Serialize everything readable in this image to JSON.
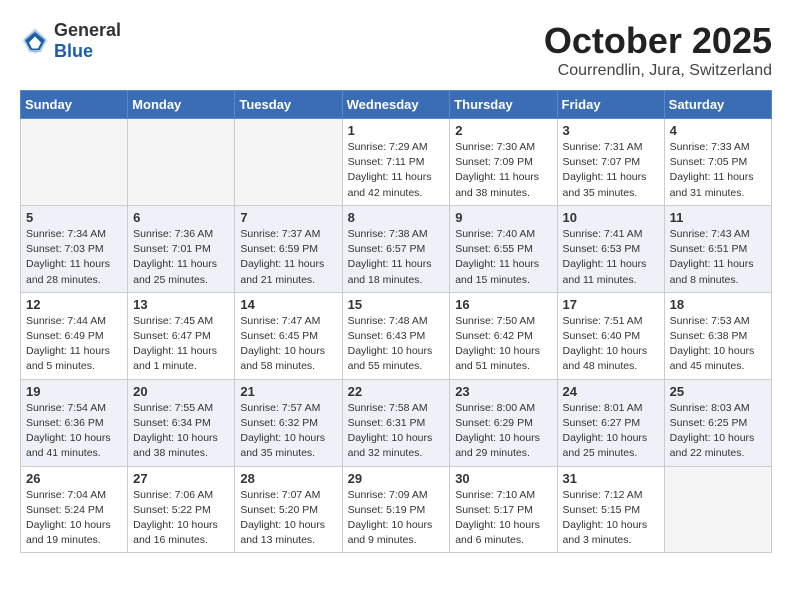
{
  "header": {
    "logo_general": "General",
    "logo_blue": "Blue",
    "month": "October 2025",
    "location": "Courrendlin, Jura, Switzerland"
  },
  "weekdays": [
    "Sunday",
    "Monday",
    "Tuesday",
    "Wednesday",
    "Thursday",
    "Friday",
    "Saturday"
  ],
  "weeks": [
    [
      {
        "day": "",
        "info": ""
      },
      {
        "day": "",
        "info": ""
      },
      {
        "day": "",
        "info": ""
      },
      {
        "day": "1",
        "info": "Sunrise: 7:29 AM\nSunset: 7:11 PM\nDaylight: 11 hours\nand 42 minutes."
      },
      {
        "day": "2",
        "info": "Sunrise: 7:30 AM\nSunset: 7:09 PM\nDaylight: 11 hours\nand 38 minutes."
      },
      {
        "day": "3",
        "info": "Sunrise: 7:31 AM\nSunset: 7:07 PM\nDaylight: 11 hours\nand 35 minutes."
      },
      {
        "day": "4",
        "info": "Sunrise: 7:33 AM\nSunset: 7:05 PM\nDaylight: 11 hours\nand 31 minutes."
      }
    ],
    [
      {
        "day": "5",
        "info": "Sunrise: 7:34 AM\nSunset: 7:03 PM\nDaylight: 11 hours\nand 28 minutes."
      },
      {
        "day": "6",
        "info": "Sunrise: 7:36 AM\nSunset: 7:01 PM\nDaylight: 11 hours\nand 25 minutes."
      },
      {
        "day": "7",
        "info": "Sunrise: 7:37 AM\nSunset: 6:59 PM\nDaylight: 11 hours\nand 21 minutes."
      },
      {
        "day": "8",
        "info": "Sunrise: 7:38 AM\nSunset: 6:57 PM\nDaylight: 11 hours\nand 18 minutes."
      },
      {
        "day": "9",
        "info": "Sunrise: 7:40 AM\nSunset: 6:55 PM\nDaylight: 11 hours\nand 15 minutes."
      },
      {
        "day": "10",
        "info": "Sunrise: 7:41 AM\nSunset: 6:53 PM\nDaylight: 11 hours\nand 11 minutes."
      },
      {
        "day": "11",
        "info": "Sunrise: 7:43 AM\nSunset: 6:51 PM\nDaylight: 11 hours\nand 8 minutes."
      }
    ],
    [
      {
        "day": "12",
        "info": "Sunrise: 7:44 AM\nSunset: 6:49 PM\nDaylight: 11 hours\nand 5 minutes."
      },
      {
        "day": "13",
        "info": "Sunrise: 7:45 AM\nSunset: 6:47 PM\nDaylight: 11 hours\nand 1 minute."
      },
      {
        "day": "14",
        "info": "Sunrise: 7:47 AM\nSunset: 6:45 PM\nDaylight: 10 hours\nand 58 minutes."
      },
      {
        "day": "15",
        "info": "Sunrise: 7:48 AM\nSunset: 6:43 PM\nDaylight: 10 hours\nand 55 minutes."
      },
      {
        "day": "16",
        "info": "Sunrise: 7:50 AM\nSunset: 6:42 PM\nDaylight: 10 hours\nand 51 minutes."
      },
      {
        "day": "17",
        "info": "Sunrise: 7:51 AM\nSunset: 6:40 PM\nDaylight: 10 hours\nand 48 minutes."
      },
      {
        "day": "18",
        "info": "Sunrise: 7:53 AM\nSunset: 6:38 PM\nDaylight: 10 hours\nand 45 minutes."
      }
    ],
    [
      {
        "day": "19",
        "info": "Sunrise: 7:54 AM\nSunset: 6:36 PM\nDaylight: 10 hours\nand 41 minutes."
      },
      {
        "day": "20",
        "info": "Sunrise: 7:55 AM\nSunset: 6:34 PM\nDaylight: 10 hours\nand 38 minutes."
      },
      {
        "day": "21",
        "info": "Sunrise: 7:57 AM\nSunset: 6:32 PM\nDaylight: 10 hours\nand 35 minutes."
      },
      {
        "day": "22",
        "info": "Sunrise: 7:58 AM\nSunset: 6:31 PM\nDaylight: 10 hours\nand 32 minutes."
      },
      {
        "day": "23",
        "info": "Sunrise: 8:00 AM\nSunset: 6:29 PM\nDaylight: 10 hours\nand 29 minutes."
      },
      {
        "day": "24",
        "info": "Sunrise: 8:01 AM\nSunset: 6:27 PM\nDaylight: 10 hours\nand 25 minutes."
      },
      {
        "day": "25",
        "info": "Sunrise: 8:03 AM\nSunset: 6:25 PM\nDaylight: 10 hours\nand 22 minutes."
      }
    ],
    [
      {
        "day": "26",
        "info": "Sunrise: 7:04 AM\nSunset: 5:24 PM\nDaylight: 10 hours\nand 19 minutes."
      },
      {
        "day": "27",
        "info": "Sunrise: 7:06 AM\nSunset: 5:22 PM\nDaylight: 10 hours\nand 16 minutes."
      },
      {
        "day": "28",
        "info": "Sunrise: 7:07 AM\nSunset: 5:20 PM\nDaylight: 10 hours\nand 13 minutes."
      },
      {
        "day": "29",
        "info": "Sunrise: 7:09 AM\nSunset: 5:19 PM\nDaylight: 10 hours\nand 9 minutes."
      },
      {
        "day": "30",
        "info": "Sunrise: 7:10 AM\nSunset: 5:17 PM\nDaylight: 10 hours\nand 6 minutes."
      },
      {
        "day": "31",
        "info": "Sunrise: 7:12 AM\nSunset: 5:15 PM\nDaylight: 10 hours\nand 3 minutes."
      },
      {
        "day": "",
        "info": ""
      }
    ]
  ]
}
